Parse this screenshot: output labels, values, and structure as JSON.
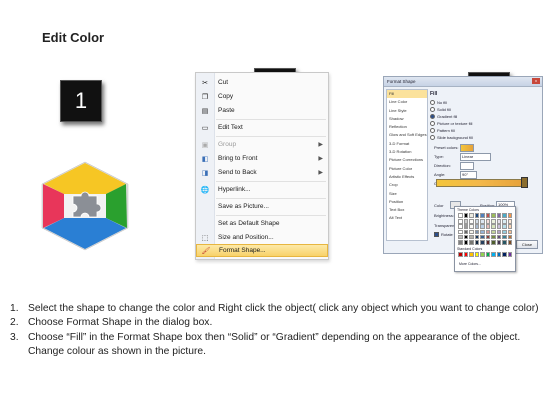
{
  "header": {
    "title": "Edit Color"
  },
  "steps": [
    {
      "number": "1"
    },
    {
      "number": "2"
    },
    {
      "number": "3"
    }
  ],
  "shape": {
    "colors": {
      "top": "#f6c624",
      "right": "#2aa02e",
      "bottom": "#2a7fd4",
      "left": "#e8365a",
      "center": "#8b8f96"
    }
  },
  "context_menu": {
    "items": [
      {
        "label": "Cut",
        "icon": "scissors-icon"
      },
      {
        "label": "Copy",
        "icon": "copy-icon"
      },
      {
        "label": "Paste",
        "icon": "paste-icon"
      },
      {
        "label": "Edit Text",
        "icon": "edit-text-icon"
      },
      {
        "label": "Group",
        "icon": "group-icon",
        "disabled": true,
        "submenu": true
      },
      {
        "label": "Bring to Front",
        "icon": "bring-front-icon",
        "submenu": true
      },
      {
        "label": "Send to Back",
        "icon": "send-back-icon",
        "submenu": true
      },
      {
        "label": "Hyperlink...",
        "icon": "hyperlink-icon"
      },
      {
        "label": "Save as Picture...",
        "icon": ""
      },
      {
        "label": "Set as Default Shape",
        "icon": ""
      },
      {
        "label": "Size and Position...",
        "icon": "size-position-icon"
      },
      {
        "label": "Format Shape...",
        "icon": "format-shape-icon",
        "highlighted": true
      }
    ]
  },
  "format_dialog": {
    "title": "Format Shape",
    "close_x": "x",
    "categories": [
      "Fill",
      "Line Color",
      "Line Style",
      "Shadow",
      "Reflection",
      "Glow and Soft Edges",
      "3-D Format",
      "3-D Rotation",
      "Picture Corrections",
      "Picture Color",
      "Artistic Effects",
      "Crop",
      "Size",
      "Position",
      "Text Box",
      "Alt Text"
    ],
    "section_title": "Fill",
    "fill_options": [
      "No fill",
      "Solid fill",
      "Gradient fill",
      "Picture or texture fill",
      "Pattern fill",
      "Slide background fill"
    ],
    "preset_colors_label": "Preset colors:",
    "type_label": "Type:",
    "type_value": "Linear",
    "direction_label": "Direction:",
    "angle_label": "Angle:",
    "angle_value": "90°",
    "gradient_stops_label": "Gradient stops",
    "color_label": "Color",
    "position_label": "Position:",
    "position_value": "100%",
    "brightness_label": "Brightness:",
    "transparency_label": "Transparency:",
    "rotate_label": "Rotate with shape",
    "close_label": "Close"
  },
  "color_palette": {
    "theme_label": "Theme Colors",
    "standard_label": "Standard Colors",
    "more_label": "More Colors...",
    "theme_top": [
      "#ffffff",
      "#000000",
      "#eeece1",
      "#1f497d",
      "#4f81bd",
      "#c0504d",
      "#9bbb59",
      "#8064a2",
      "#4bacc6",
      "#f79646"
    ],
    "standard": [
      "#c00000",
      "#ff0000",
      "#ffc000",
      "#ffff00",
      "#92d050",
      "#00b050",
      "#00b0f0",
      "#0070c0",
      "#002060",
      "#7030a0"
    ]
  },
  "instructions": [
    {
      "num": "1.",
      "text": "Select the shape to change the color and Right click the object( click any object which you want to change color)"
    },
    {
      "num": "2.",
      "text": "Choose Format Shape in the dialog box."
    },
    {
      "num": "3.",
      "text": "Choose “Fill” in the Format Shape box then “Solid” or “Gradient” depending on the appearance of the object. Change colour as shown in the picture."
    }
  ]
}
